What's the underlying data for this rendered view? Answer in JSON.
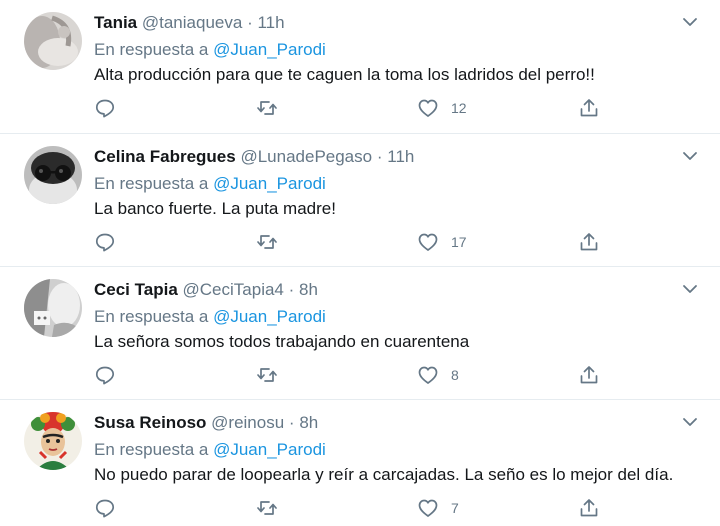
{
  "reply_prefix": "En respuesta a",
  "tweets": [
    {
      "name": "Tania",
      "handle": "@taniaqueva",
      "separator": "·",
      "time": "11h",
      "reply_to": "@Juan_Parodi",
      "text": "Alta producción para que te caguen la toma los ladridos del perro!!",
      "likes": "12"
    },
    {
      "name": "Celina Fabregues",
      "handle": "@LunadePegaso",
      "separator": "·",
      "time": "11h",
      "reply_to": "@Juan_Parodi",
      "text": "La banco fuerte. La puta madre!",
      "likes": "17"
    },
    {
      "name": "Ceci Tapia",
      "handle": "@CeciTapia4",
      "separator": "·",
      "time": "8h",
      "reply_to": "@Juan_Parodi",
      "text": "La señora somos todos trabajando en cuarentena",
      "likes": "8"
    },
    {
      "name": "Susa Reinoso",
      "handle": "@reinosu",
      "separator": "·",
      "time": "8h",
      "reply_to": "@Juan_Parodi",
      "text": "No puedo parar de loopearla y reír a carcajadas. La seño es lo mejor del día.",
      "likes": "7"
    }
  ],
  "icons": {
    "reply": "reply-icon",
    "retweet": "retweet-icon",
    "like": "heart-icon",
    "share": "share-icon",
    "menu": "chevron-down-icon"
  },
  "colors": {
    "text": "#14171a",
    "secondary": "#657786",
    "mention": "#1b95e0",
    "divider": "#e6ecf0",
    "icon": "#657786"
  }
}
